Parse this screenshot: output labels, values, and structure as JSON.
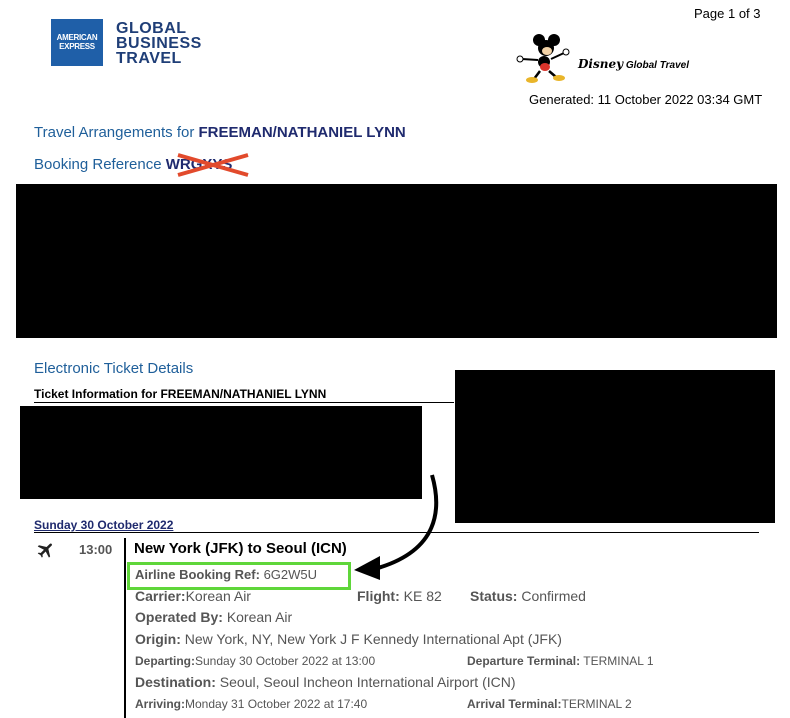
{
  "header": {
    "amex_line1": "AMERICAN",
    "amex_line2": "EXPRESS",
    "gbt_lines": [
      "GLOBAL",
      "BUSINESS",
      "TRAVEL"
    ],
    "page": "Page 1 of 3",
    "disney_brand": "Disney",
    "disney_suffix": " Global Travel",
    "generated": "Generated: 11 October 2022 03:34 GMT"
  },
  "arrangements": {
    "label": "Travel Arrangements for ",
    "traveler": "FREEMAN/NATHANIEL LYNN",
    "booking_label": "Booking Reference ",
    "booking_code": "WRGXYS"
  },
  "ticket": {
    "section_title": "Electronic Ticket Details",
    "info_label": "Ticket Information for ",
    "info_name": "FREEMAN/NATHANIEL LYNN"
  },
  "itinerary": {
    "day": "Sunday 30 October 2022",
    "segment": {
      "time": "13:00",
      "route": "New York (JFK) to Seoul (ICN)",
      "airline_ref_label": "Airline Booking Ref:",
      "airline_ref": "6G2W5U",
      "carrier_label": "Carrier:",
      "carrier": "Korean Air",
      "flight_label": "Flight:",
      "flight": "KE 82",
      "status_label": "Status:",
      "status": "Confirmed",
      "operated_label": "Operated By:",
      "operated": "Korean Air",
      "origin_label": "Origin:",
      "origin": "New York, NY, New York J F Kennedy International Apt (JFK)",
      "departing_label": "Departing:",
      "departing": "Sunday 30 October 2022 at 13:00",
      "dep_terminal_label": "Departure Terminal:",
      "dep_terminal": "TERMINAL 1",
      "destination_label": "Destination:",
      "destination": "Seoul, Seoul Incheon International Airport (ICN)",
      "arriving_label": "Arriving:",
      "arriving": "Monday 31 October 2022 at 17:40",
      "arr_terminal_label": "Arrival Terminal:",
      "arr_terminal": "TERMINAL 2"
    }
  },
  "colors": {
    "brand_blue": "#1f5fa8",
    "heading_blue": "#1f5f9a",
    "highlight_green": "#5fd63a",
    "strike_red": "#e24a2c"
  }
}
